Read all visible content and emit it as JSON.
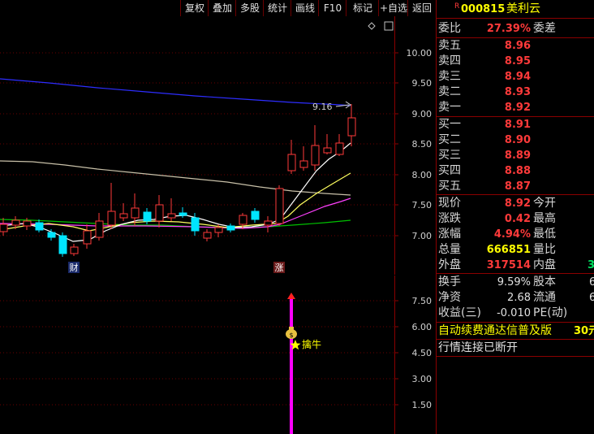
{
  "toolbar": {
    "buttons": [
      "复权",
      "叠加",
      "多股",
      "统计",
      "画线",
      "F10",
      "标记",
      "+自选",
      "返回"
    ]
  },
  "header": {
    "r_badge": "R",
    "code": "000815",
    "name": "美利云"
  },
  "kline": {
    "price_axis": [
      "10.00",
      "9.50",
      "9.00",
      "8.50",
      "8.00",
      "7.50",
      "7.00"
    ],
    "ma_label": "9.16",
    "markers": {
      "cai": "财",
      "zhang": "涨"
    },
    "colors": {
      "up": "#ff3a3a",
      "down": "#00e5ff",
      "ma_blue": "#2d2dff",
      "ma_tan": "#c8c0a8",
      "ma_white": "#ffffff",
      "ma_yellow": "#ffff60",
      "ma_magenta": "#ff40ff",
      "ma_green": "#00c000"
    }
  },
  "indicator": {
    "axis": [
      "7.50",
      "6.00",
      "4.50",
      "3.00",
      "1.50"
    ],
    "signal_label": "擒牛",
    "signal_icon": "money-bag-icon",
    "bar_color": "#ff00ff"
  },
  "quote": {
    "weibi": {
      "label": "委比",
      "value": "27.39%",
      "label2": "委差"
    },
    "asks": [
      {
        "label": "卖五",
        "price": "8.96"
      },
      {
        "label": "卖四",
        "price": "8.95"
      },
      {
        "label": "卖三",
        "price": "8.94"
      },
      {
        "label": "卖二",
        "price": "8.93"
      },
      {
        "label": "卖一",
        "price": "8.92"
      }
    ],
    "bids": [
      {
        "label": "买一",
        "price": "8.91"
      },
      {
        "label": "买二",
        "price": "8.90"
      },
      {
        "label": "买三",
        "price": "8.89"
      },
      {
        "label": "买四",
        "price": "8.88"
      },
      {
        "label": "买五",
        "price": "8.87"
      }
    ],
    "stats": [
      {
        "label": "现价",
        "value": "8.92",
        "label2": "今开",
        "color": "#ff3a3a"
      },
      {
        "label": "涨跌",
        "value": "0.42",
        "label2": "最高",
        "color": "#ff3a3a"
      },
      {
        "label": "涨幅",
        "value": "4.94%",
        "label2": "最低",
        "color": "#ff3a3a"
      },
      {
        "label": "总量",
        "value": "666851",
        "label2": "量比",
        "color": "#ffff00"
      },
      {
        "label": "外盘",
        "value": "317514",
        "label2": "内盘",
        "value2": "3",
        "color": "#ff3a3a"
      }
    ],
    "fundamentals": [
      {
        "label": "换手",
        "value": "9.59%",
        "label2": "股本",
        "value2": "6"
      },
      {
        "label": "净资",
        "value": "2.68",
        "label2": "流通",
        "value2": "6"
      },
      {
        "label": "收益(三)",
        "value": "-0.010",
        "label2": "PE(动)",
        "value2": ""
      }
    ],
    "ad_text": "自动续费通达信普及版",
    "ad_price": "30元",
    "status": "行情连接已断开"
  }
}
